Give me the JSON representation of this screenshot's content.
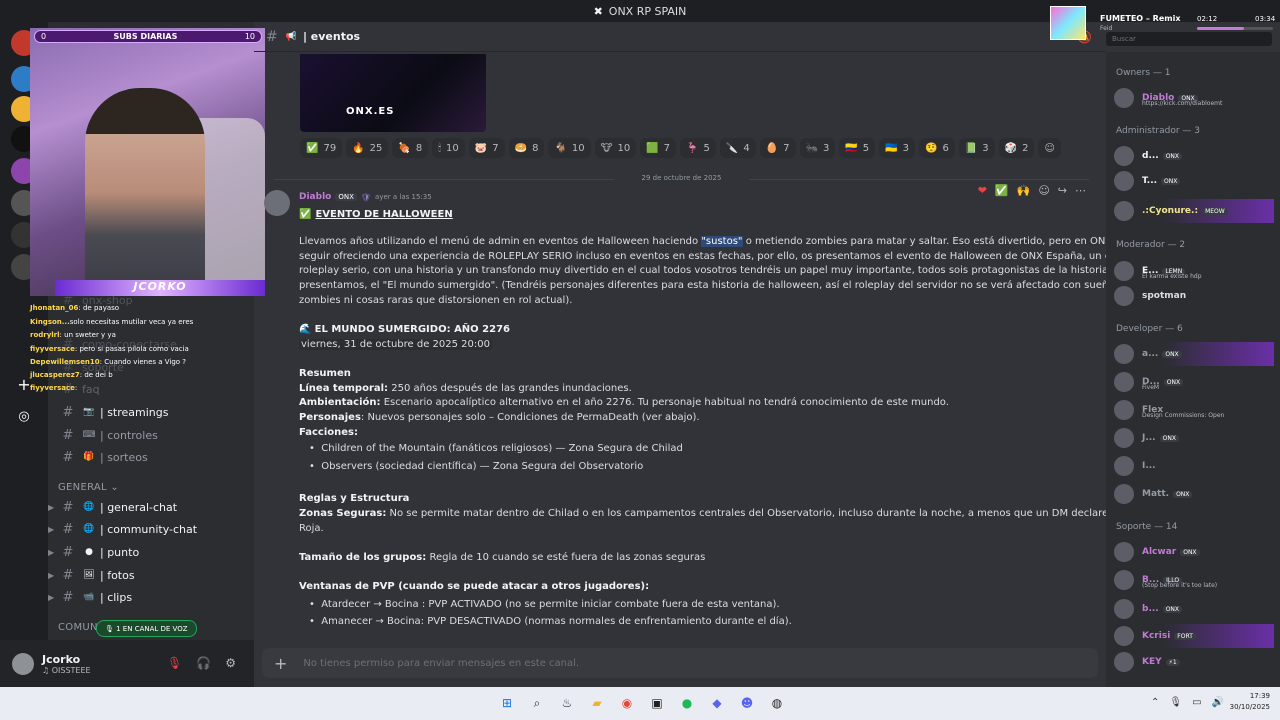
{
  "window": {
    "title": "ONX RP SPAIN"
  },
  "webcam": {
    "subs_left": "0",
    "subs_label": "SUBS DIARIAS",
    "subs_right": "10",
    "banner": "JCORKO"
  },
  "stream_chat": [
    {
      "user": "Jhonatan_06",
      "text": ": de payaso"
    },
    {
      "user": "Kingson...",
      "text": "solo necesitas mutilar veca ya eres"
    },
    {
      "user": "rodrylrl",
      "text": ": un sweter y ya"
    },
    {
      "user": "fiyyversace",
      "text": ": pero si pasas pilola como vacia"
    },
    {
      "user": "Depewillemsen10",
      "text": ": Cuando vienes a Vigo ?"
    },
    {
      "user": "jlucasperez7",
      "text": ": de dei b"
    },
    {
      "user": "fiyyversace",
      "text": ":"
    }
  ],
  "channels": {
    "faded": [
      "onx-shop",
      "como-conectarse",
      "soporte",
      "faq"
    ],
    "items": [
      {
        "label": "| streamings",
        "emoji": "📷",
        "active": true
      },
      {
        "label": "| controles",
        "emoji": "⌨",
        "active": false
      },
      {
        "label": "| sorteos",
        "emoji": "🎁",
        "active": false
      }
    ],
    "general_label": "GENERAL",
    "general": [
      {
        "label": "| general-chat",
        "emoji": "🌐"
      },
      {
        "label": "| community-chat",
        "emoji": "🌐"
      },
      {
        "label": "| punto",
        "emoji": "●"
      },
      {
        "label": "| fotos",
        "emoji": "🖼"
      },
      {
        "label": "| clips",
        "emoji": "📹"
      }
    ],
    "community_label": "COMUNI"
  },
  "voice_pill": "1 EN CANAL DE VOZ",
  "user_panel": {
    "name": "Jcorko",
    "status": "OISSTEEE"
  },
  "header": {
    "channel": "| eventos"
  },
  "preview": {
    "logo": "ONX.ES"
  },
  "reactions": [
    {
      "emoji": "✅",
      "count": "79"
    },
    {
      "emoji": "🔥",
      "count": "25"
    },
    {
      "emoji": "🍖",
      "count": "8"
    },
    {
      "emoji": "🕯",
      "count": "10"
    },
    {
      "emoji": "🐷",
      "count": "7"
    },
    {
      "emoji": "🥯",
      "count": "8"
    },
    {
      "emoji": "🐐",
      "count": "10"
    },
    {
      "emoji": "🐮",
      "count": "10"
    },
    {
      "emoji": "🟩",
      "count": "7"
    },
    {
      "emoji": "🦩",
      "count": "5"
    },
    {
      "emoji": "🔪",
      "count": "4"
    },
    {
      "emoji": "🥚",
      "count": "7"
    },
    {
      "emoji": "🐜",
      "count": "3"
    },
    {
      "emoji": "🇨🇴",
      "count": "5"
    },
    {
      "emoji": "🇺🇦",
      "count": "3"
    },
    {
      "emoji": "🤨",
      "count": "6"
    },
    {
      "emoji": "📗",
      "count": "3"
    },
    {
      "emoji": "🎲",
      "count": "2"
    }
  ],
  "date_divider": "29 de octubre de 2025",
  "message": {
    "author": "Diablo",
    "badge": "ONX",
    "time": "ayer a las 15:35",
    "title": "EVENTO DE HALLOWEEN",
    "intro": [
      "Llevamos años utilizando el menú de admin en eventos de Halloween haciendo ",
      "\"sustos\"",
      " o metiendo zombies para matar y saltar. Eso está divertido, pero en ONX queremos"
    ],
    "p2": "seguir ofreciendo una experiencia de ROLEPLAY SERIO incluso en eventos en estas fechas, por ello, os presentamos el evento de Halloween de ONX España, un evento de",
    "p3": "roleplay serio, con una historia y un transfondo muy divertido en el cual todos vosotros tendréis un papel muy importante, todos sois protagonistas de la historia, os",
    "p4": "presentamos, el \"El mundo sumergido\". (Tendréis personajes diferentes para esta historia de halloween, así el roleplay del servidor no se verá afectado con sueños de",
    "p5": "zombies ni cosas raras que distorsionen en rol actual).",
    "section_title": "EL MUNDO SUMERGIDO: AÑO 2276",
    "section_date": "viernes, 31 de octubre de 2025 20:00",
    "resumen": "Resumen",
    "linea_label": "Línea temporal:",
    "linea_text": " 250 años después de las grandes inundaciones.",
    "amb_label": "Ambientación:",
    "amb_text": " Escenario apocalíptico alternativo en el año 2276. Tu personaje habitual no tendrá conocimiento de este mundo.",
    "pers_label": "Personajes",
    "pers_text": ": Nuevos personajes solo – Condiciones de PermaDeath (ver abajo).",
    "facc_label": "Facciones:",
    "facc_1": "Children of the Mountain (fanáticos religiosos) — Zona Segura de Chilad",
    "facc_2": "Observers (sociedad científica) — Zona Segura del Observatorio",
    "reglas": "Reglas y Estructura",
    "zonas_label": "Zonas Seguras:",
    "zonas_text": " No se permite matar dentro de Chilad o en los campamentos centrales del Observatorio, incluso durante la noche, a menos que un DM declare una Zona",
    "zonas_text2": "Roja.",
    "grupos_label": "Tamaño de los grupos:",
    "grupos_text": " Regla de 10 cuando se esté fuera de las zonas seguras",
    "pvp_label": "Ventanas de PVP (cuando se puede atacar a otros jugadores):",
    "pvp_1": "Atardecer → Bocina : PVP ACTIVADO (no se permite iniciar combate fuera de esta ventana).",
    "pvp_2": "Amanecer → Bocina: PVP DESACTIVADO (normas normales de enfrentamiento durante el día)."
  },
  "input": {
    "placeholder": "No tienes permiso para enviar mensajes en este canal."
  },
  "search": {
    "placeholder": "Buscar"
  },
  "now_playing": {
    "track": "FUMETEO – Remix",
    "artist": "Feid",
    "elapsed": "02:12",
    "total": "03:34",
    "progress": 0.62
  },
  "members": {
    "owners": "Owners — 1",
    "administrador": "Administrador — 3",
    "moderador": "Moderador — 2",
    "developer": "Developer — 6",
    "soporte": "Soporte — 14",
    "list": [
      {
        "name": "Diablo",
        "tag": "ONX",
        "sub": "https://kick.com/diabloemt",
        "color": "#c27bd6"
      },
      {
        "name": "d...",
        "tag": "ONX",
        "sub": "",
        "color": "#f2f3f5"
      },
      {
        "name": "T...",
        "tag": "ONX",
        "sub": "",
        "color": "#f2f3f5"
      },
      {
        "name": ".:Cyonure.:",
        "tag": "MEOW",
        "sub": "",
        "color": "#f0e68c"
      },
      {
        "name": "E...",
        "tag": "LEMN",
        "sub": "El karma existe hdp",
        "color": "#f2f3f5"
      },
      {
        "name": "spotman",
        "tag": "",
        "sub": "",
        "color": "#dbdee1"
      },
      {
        "name": "a...",
        "tag": "ONX",
        "sub": "",
        "color": "#949ba4"
      },
      {
        "name": "D...",
        "tag": "ONX",
        "sub": "FiveM",
        "color": "#949ba4"
      },
      {
        "name": "Flex",
        "tag": "",
        "sub": "Design Commissions: Open",
        "color": "#949ba4"
      },
      {
        "name": "J...",
        "tag": "ONX",
        "sub": "",
        "color": "#949ba4"
      },
      {
        "name": "I...",
        "tag": "",
        "sub": "",
        "color": "#949ba4"
      },
      {
        "name": "Matt.",
        "tag": "ONX",
        "sub": "",
        "color": "#949ba4"
      },
      {
        "name": "Alcwar",
        "tag": "ONX",
        "sub": "",
        "color": "#c27bd6"
      },
      {
        "name": "B...",
        "tag": "ILLO",
        "sub": "(Stop before it's too late)",
        "color": "#c27bd6"
      },
      {
        "name": "b...",
        "tag": "ONX",
        "sub": "",
        "color": "#c27bd6"
      },
      {
        "name": "Kcrisi",
        "tag": "FORT",
        "sub": "",
        "color": "#c27bd6"
      },
      {
        "name": "KEY",
        "tag": "⚡1",
        "sub": "",
        "color": "#c27bd6"
      }
    ]
  },
  "taskbar": {
    "time": "17:39",
    "date": "30/10/2025"
  }
}
